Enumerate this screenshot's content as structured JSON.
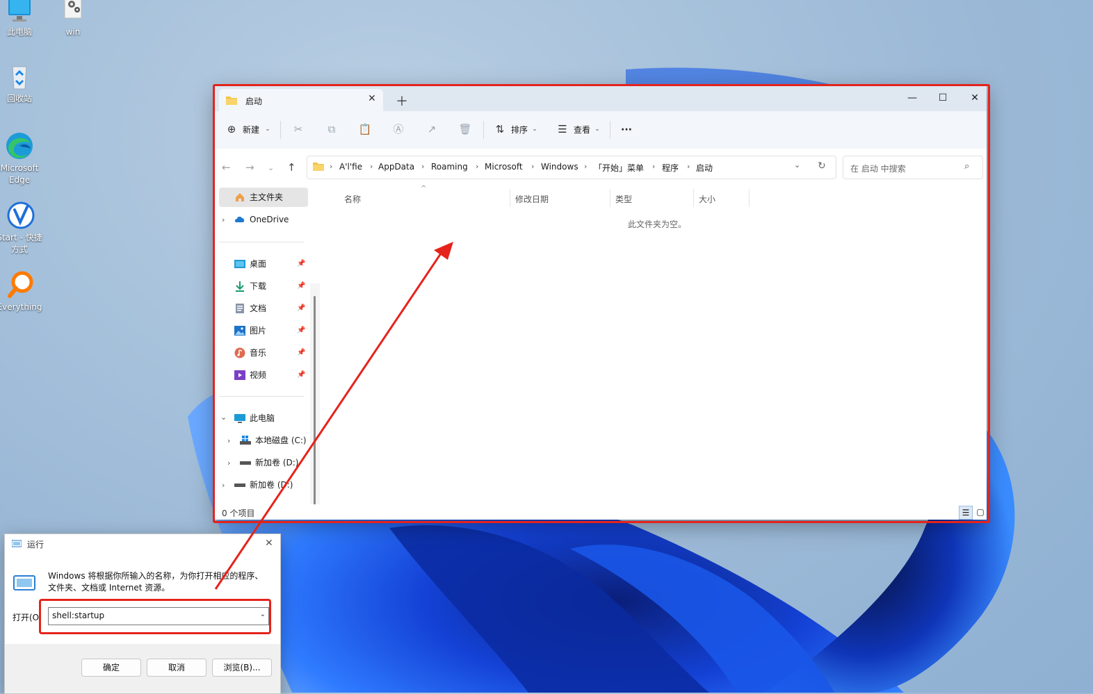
{
  "desktop": {
    "icons": [
      {
        "label": "此电脑"
      },
      {
        "label": "win"
      },
      {
        "label": "回收站"
      },
      {
        "label": "Microsoft Edge"
      },
      {
        "label": "Start - 快捷方式"
      },
      {
        "label": "Everything"
      }
    ]
  },
  "explorer": {
    "tab_title": "启动",
    "toolbar": {
      "new_label": "新建",
      "sort_label": "排序",
      "view_label": "查看",
      "more_label": "···"
    },
    "breadcrumb": [
      "A'l'fie",
      "AppData",
      "Roaming",
      "Microsoft",
      "Windows",
      "「开始」菜单",
      "程序",
      "启动"
    ],
    "search_placeholder": "在 启动 中搜索",
    "nav": {
      "home": "主文件夹",
      "onedrive": "OneDrive",
      "quick": [
        "桌面",
        "下载",
        "文档",
        "图片",
        "音乐",
        "视频"
      ],
      "this_pc": "此电脑",
      "drives": [
        "本地磁盘 (C:)",
        "新加卷 (D:)",
        "新加卷 (D:)"
      ]
    },
    "columns": [
      "名称",
      "修改日期",
      "类型",
      "大小"
    ],
    "empty_text": "此文件夹为空。",
    "status_count": "0 个项目"
  },
  "run_dialog": {
    "title": "运行",
    "description_line1": "Windows 将根据你所输入的名称，为你打开相应的程序、",
    "description_line2": "文件夹、文档或 Internet 资源。",
    "open_label": "打开(O",
    "input_value": "shell:startup",
    "ok_label": "确定",
    "cancel_label": "取消",
    "browse_label": "浏览(B)..."
  },
  "colors": {
    "highlight": "#e5231b",
    "accent": "#0067c0"
  }
}
